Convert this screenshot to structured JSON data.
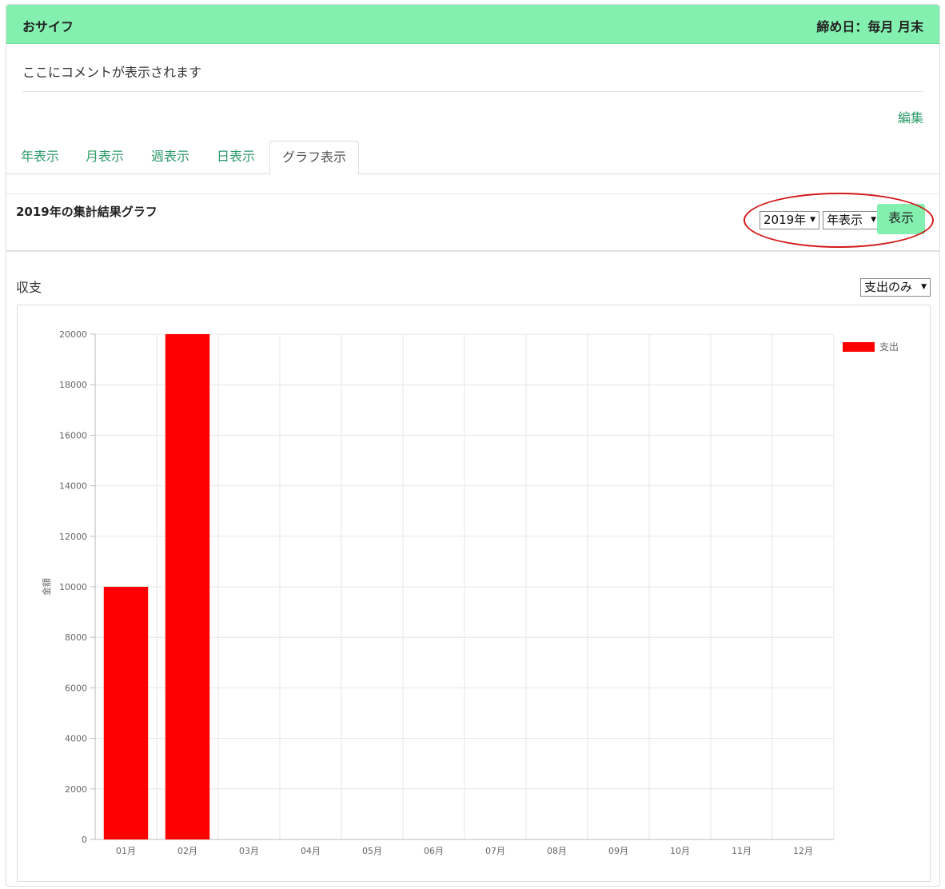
{
  "header": {
    "title": "おサイフ",
    "closing": "締め日：毎月 月末"
  },
  "comment": "ここにコメントが表示されます",
  "edit_label": "編集",
  "tabs": [
    {
      "label": "年表示",
      "active": false
    },
    {
      "label": "月表示",
      "active": false
    },
    {
      "label": "週表示",
      "active": false
    },
    {
      "label": "日表示",
      "active": false
    },
    {
      "label": "グラフ表示",
      "active": true
    }
  ],
  "graph_section": {
    "title": "2019年の集計結果グラフ",
    "year_select": "2019年",
    "mode_select": "年表示",
    "show_button": "表示",
    "annotation_color": "#d21a1a"
  },
  "chart_section": {
    "label": "収支",
    "filter_select": "支出のみ"
  },
  "chart_data": {
    "type": "bar",
    "categories": [
      "01月",
      "02月",
      "03月",
      "04月",
      "05月",
      "06月",
      "07月",
      "08月",
      "09月",
      "10月",
      "11月",
      "12月"
    ],
    "series": [
      {
        "name": "支出",
        "color": "#ff0000",
        "values": [
          10000,
          20000,
          0,
          0,
          0,
          0,
          0,
          0,
          0,
          0,
          0,
          0
        ]
      }
    ],
    "ylabel": "金額",
    "ylim": [
      0,
      20000
    ],
    "yticks": [
      0,
      2000,
      4000,
      6000,
      8000,
      10000,
      12000,
      14000,
      16000,
      18000,
      20000
    ],
    "grid": true,
    "legend_position": "top-right"
  },
  "colors": {
    "accent": "#83f0b0",
    "link": "#2e9b6a"
  }
}
